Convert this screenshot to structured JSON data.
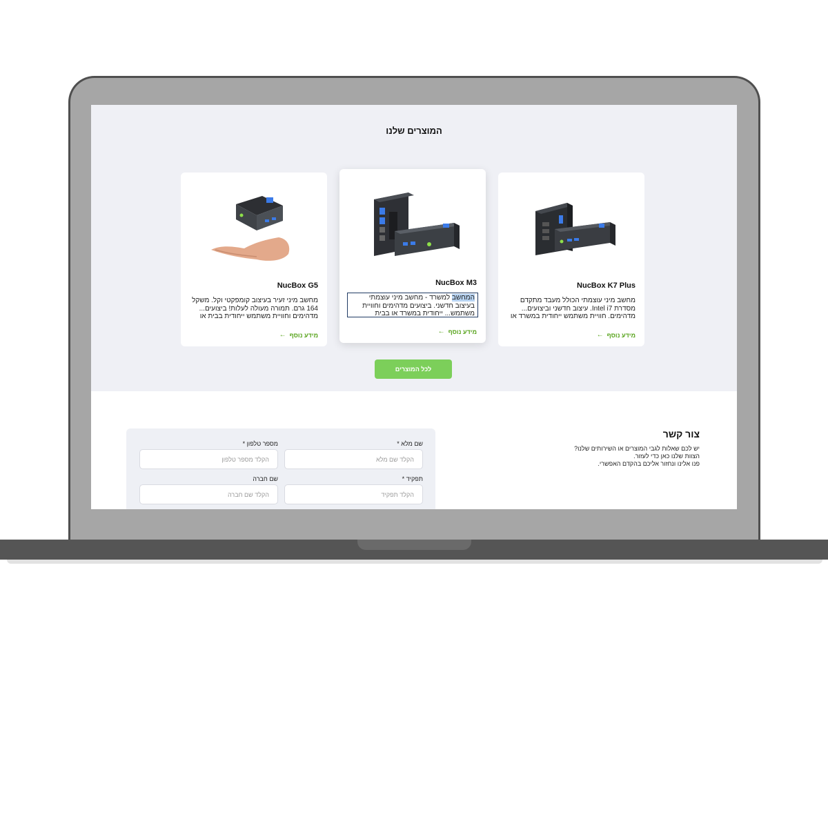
{
  "products": {
    "title": "המוצרים שלנו",
    "items": [
      {
        "name": "NucBox K7 Plus",
        "description": "מחשב מיני עוצמתי הכולל מעבד מתקדם מסדרת Intel i7. עיצוב חדשני וביצועים... מדהימים. חוויית משתמש ייחודית במשרד או",
        "more": "מידע נוסף"
      },
      {
        "name": "NucBox M3",
        "description_highlight": "המחשב",
        "description": " למשרד - מחשב מיני עוצמתי בעיצוב חדשני. ביצועים מדהימים וחוויית משתמש... ייחודית במשרד או בבית",
        "more": "מידע נוסף"
      },
      {
        "name": "NucBox G5",
        "description": "מחשב מיני זעיר בעיצוב קומפקטי וקל. משקל 164 גרם. תמורה מעולה לעלות! ביצועים... מדהימים וחוויית משתמש ייחודית בבית או",
        "more": "מידע נוסף"
      }
    ],
    "all_button": "לכל המוצרים"
  },
  "contact": {
    "title": "צור קשר",
    "text_line1": "יש לכם שאלות לגבי המוצרים או השירותים שלנו?",
    "text_line2": "הצוות שלנו כאן כדי לעזור.",
    "text_line3": "פנו אלינו ונחזור אליכם בהקדם האפשרי.",
    "fields": {
      "full_name_label": "שם מלא *",
      "full_name_placeholder": "הקלד שם מלא",
      "phone_label": "מספר טלפון *",
      "phone_placeholder": "הקלד מספר טלפון",
      "role_label": "תפקיד *",
      "role_placeholder": "הקלד תפקיד",
      "company_label": "שם חברה",
      "company_placeholder": "הקלד שם חברה"
    }
  },
  "colors": {
    "accent_green": "#7ccf5a",
    "link_green": "#5aa51f",
    "section_bg": "#eff0f5"
  }
}
